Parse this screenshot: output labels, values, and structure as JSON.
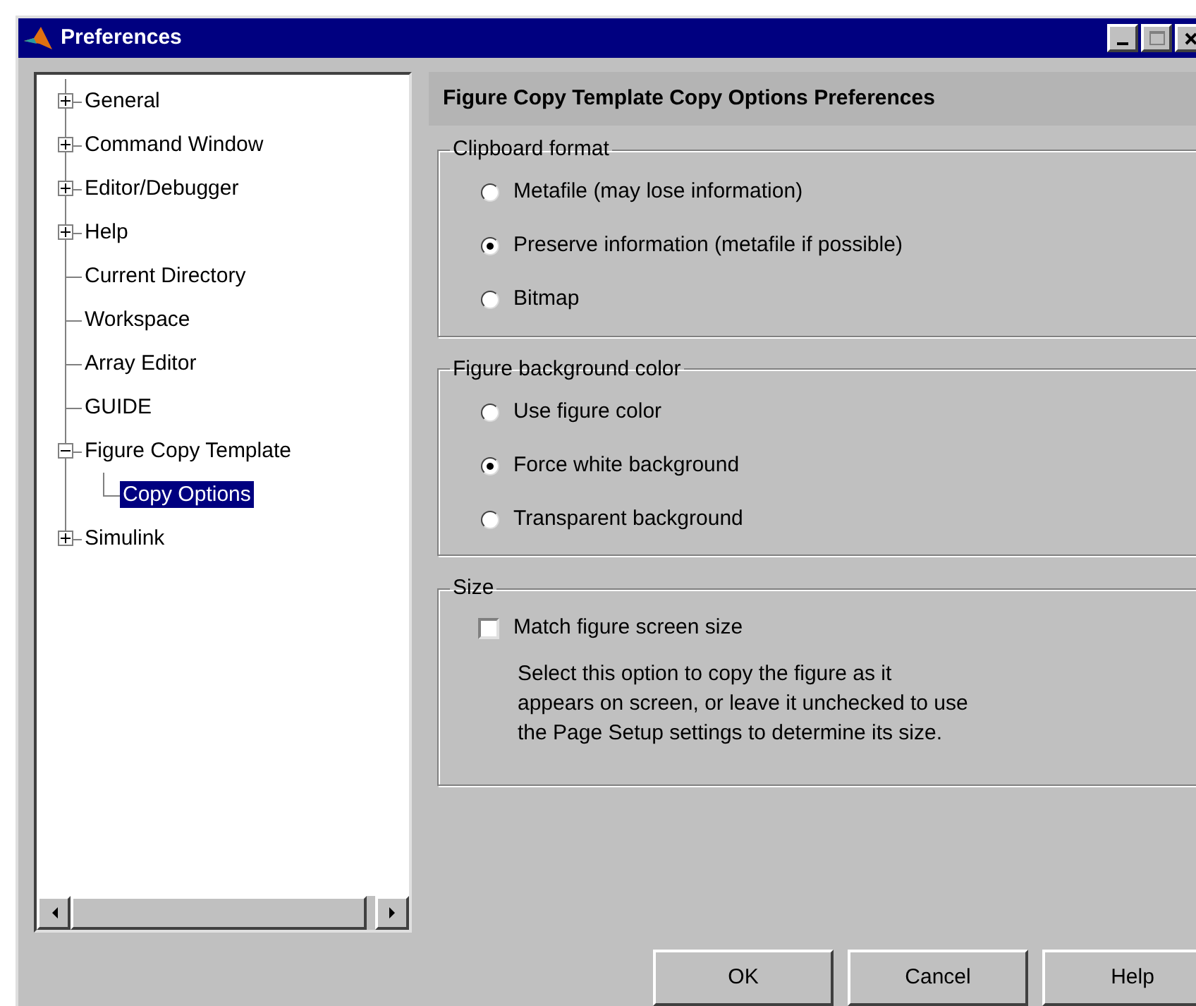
{
  "window": {
    "title": "Preferences"
  },
  "tree": [
    {
      "label": "General",
      "kind": "node",
      "expanded": false,
      "selected": false
    },
    {
      "label": "Command Window",
      "kind": "node",
      "expanded": false,
      "selected": false
    },
    {
      "label": "Editor/Debugger",
      "kind": "node",
      "expanded": false,
      "selected": false
    },
    {
      "label": "Help",
      "kind": "node",
      "expanded": false,
      "selected": false
    },
    {
      "label": "Current Directory",
      "kind": "leaf",
      "selected": false
    },
    {
      "label": "Workspace",
      "kind": "leaf",
      "selected": false
    },
    {
      "label": "Array Editor",
      "kind": "leaf",
      "selected": false
    },
    {
      "label": "GUIDE",
      "kind": "leaf",
      "selected": false
    },
    {
      "label": "Figure Copy Template",
      "kind": "node",
      "expanded": true,
      "selected": false,
      "children": [
        {
          "label": "Copy Options",
          "kind": "leaf",
          "selected": true
        }
      ]
    },
    {
      "label": "Simulink",
      "kind": "node",
      "expanded": false,
      "selected": false
    }
  ],
  "panel": {
    "title": "Figure Copy Template Copy Options Preferences",
    "groups": [
      {
        "title": "Clipboard format",
        "kind": "radios",
        "options": [
          {
            "label": "Metafile (may lose information)",
            "selected": false
          },
          {
            "label": "Preserve information (metafile if possible)",
            "selected": true
          },
          {
            "label": "Bitmap",
            "selected": false
          }
        ]
      },
      {
        "title": "Figure background color",
        "kind": "radios",
        "options": [
          {
            "label": "Use figure color",
            "selected": false
          },
          {
            "label": "Force white background",
            "selected": true
          },
          {
            "label": "Transparent background",
            "selected": false
          }
        ]
      },
      {
        "title": "Size",
        "kind": "checkbox",
        "checkbox": {
          "label": "Match figure screen size",
          "checked": false
        },
        "description_lines": [
          "Select this option to copy the figure as it",
          "appears on screen, or leave it unchecked to use",
          "the Page Setup settings to determine its size."
        ]
      }
    ]
  },
  "buttons": [
    "OK",
    "Cancel",
    "Help"
  ]
}
